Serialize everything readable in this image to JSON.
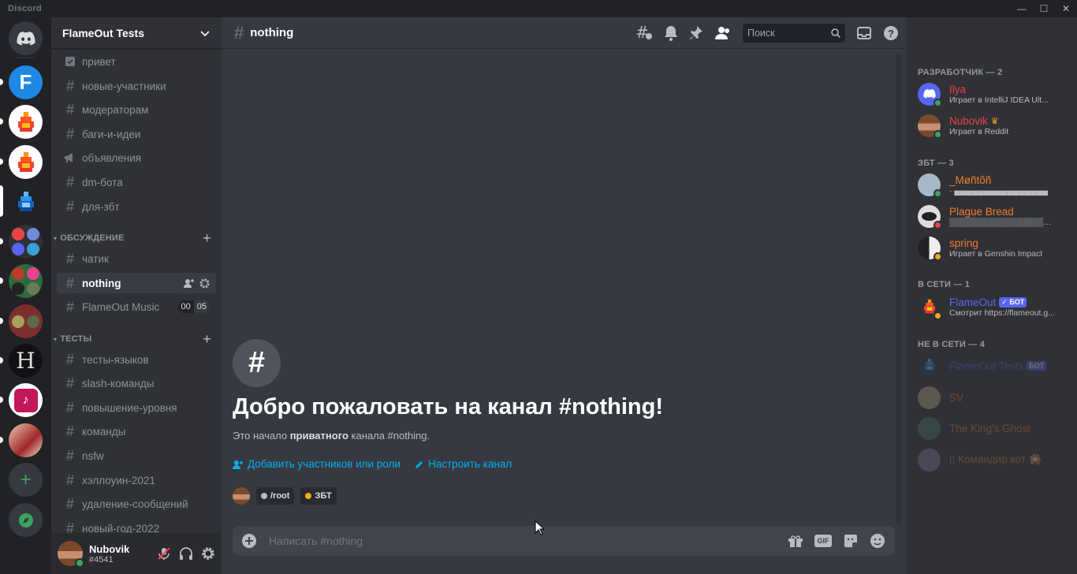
{
  "app": {
    "title": "Discord"
  },
  "colors": {
    "accent": "#5865f2",
    "online": "#3ba55d",
    "idle": "#faa81a",
    "dnd": "#ed4245",
    "link": "#00aff4"
  },
  "server": {
    "name": "FlameOut Tests"
  },
  "channels_top": [
    {
      "name": "привет",
      "icon": "rules-icon"
    },
    {
      "name": "новые-участники",
      "icon": "hash-icon"
    },
    {
      "name": "модераторам",
      "icon": "hash-icon"
    },
    {
      "name": "баги-и-идеи",
      "icon": "hash-icon"
    },
    {
      "name": "объявления",
      "icon": "announcement-icon"
    },
    {
      "name": "dm-бота",
      "icon": "hash-icon"
    },
    {
      "name": "для-збт",
      "icon": "hash-icon"
    }
  ],
  "category_discussion": {
    "name": "ОБСУЖДЕНИЕ"
  },
  "channels_discussion": [
    {
      "name": "чатик"
    },
    {
      "name": "nothing"
    },
    {
      "name": "FlameOut Music",
      "badge_a": "00",
      "badge_b": "05"
    }
  ],
  "category_tests": {
    "name": "ТЕСТЫ"
  },
  "channels_tests": [
    {
      "name": "тесты-языков"
    },
    {
      "name": "slash-команды"
    },
    {
      "name": "повышение-уровня"
    },
    {
      "name": "команды"
    },
    {
      "name": "nsfw"
    },
    {
      "name": "хэллоуин-2021"
    },
    {
      "name": "удаление-сообщений"
    },
    {
      "name": "новый-год-2022"
    }
  ],
  "user": {
    "name": "Nubovik",
    "tag": "#4541"
  },
  "header": {
    "channel": "nothing",
    "search_placeholder": "Поиск"
  },
  "welcome": {
    "title": "Добро пожаловать на канал #nothing!",
    "sub_prefix": "Это начало ",
    "sub_bold": "приватного",
    "sub_suffix": " канала #nothing.",
    "action_add": "Добавить участников или роли",
    "action_edit": "Настроить канал",
    "role_1": "/root",
    "role_1_color": "#b9bbbe",
    "role_2": "ЗБТ",
    "role_2_color": "#faa81a"
  },
  "composer": {
    "placeholder": "Написать #nothing"
  },
  "members": {
    "group_dev": "РАЗРАБОТЧИК — 2",
    "group_zbt": "ЗБТ — 3",
    "group_online": "В СЕТИ — 1",
    "group_offline": "НЕ В СЕТИ — 4",
    "list": [
      {
        "name": "Ilya",
        "activity": "Играет в IntelliJ IDEA Ult...",
        "color": "#ed4245"
      },
      {
        "name": "Nubovik",
        "activity": "Играет в Reddit",
        "color": "#ed4245"
      },
      {
        "name": "_Møñtõñ",
        "activity": "· ▄▄▄▄▄▄▄▄▄▄▄▄▄▄▄▄",
        "color": "#f47b2a"
      },
      {
        "name": "Plague Bread",
        "activity": "▒▒▒▒▒▒▒▒▒▒▒▒▒▒▒▒▒▒▒▒▒▒",
        "color": "#f47b2a"
      },
      {
        "name": "spring",
        "activity": "Играет в Genshin Impact",
        "color": "#f47b2a"
      },
      {
        "name": "FlameOut",
        "activity": "Смотрит https://flameout.g...",
        "color": "#5865f2",
        "tag": "✓ БОТ"
      },
      {
        "name": "FlameOut Tests",
        "activity": "",
        "color": "#5865f2",
        "tag": "БОТ"
      },
      {
        "name": "SV",
        "activity": "",
        "color": "#f47b2a"
      },
      {
        "name": "The King's Ghost",
        "activity": "",
        "color": "#f47b2a"
      },
      {
        "name": "▯ Командир кот 🎇",
        "activity": "",
        "color": "#f47b2a"
      }
    ]
  }
}
